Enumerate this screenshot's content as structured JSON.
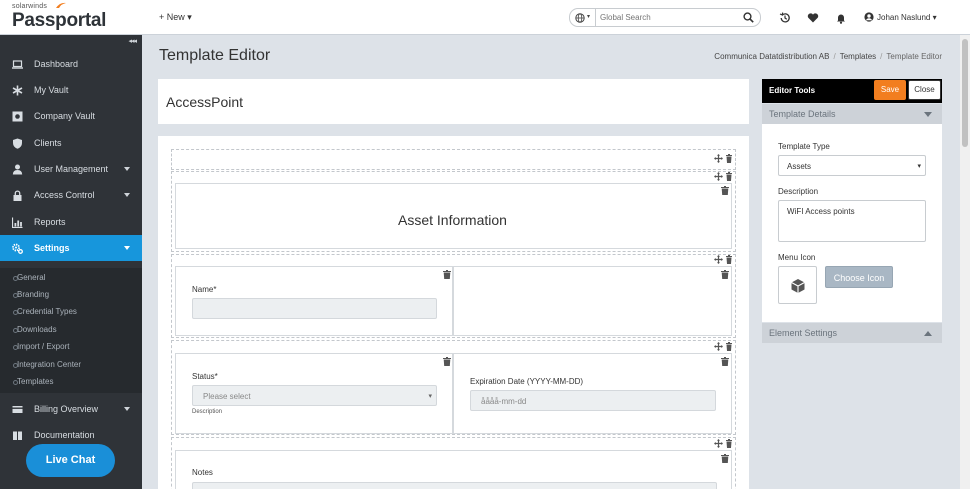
{
  "header": {
    "brand_small": "solarwinds",
    "brand_big": "Passportal",
    "new_label": "+ New ▾",
    "search_placeholder": "Global Search",
    "user_name": "Johan Naslund ▾",
    "icons": [
      "globe-icon",
      "search-icon",
      "history-icon",
      "heart-icon",
      "bell-icon",
      "user-circle-icon"
    ]
  },
  "sidebar": {
    "collapse_glyph": "◂◂◂",
    "items": [
      {
        "label": "Dashboard",
        "icon": "laptop-icon",
        "caret": false
      },
      {
        "label": "My Vault",
        "icon": "asterisk-icon",
        "caret": false
      },
      {
        "label": "Company Vault",
        "icon": "safe-icon",
        "caret": false
      },
      {
        "label": "Clients",
        "icon": "shield-icon",
        "caret": false
      },
      {
        "label": "User Management",
        "icon": "user-icon",
        "caret": true
      },
      {
        "label": "Access Control",
        "icon": "lock-icon",
        "caret": true
      },
      {
        "label": "Reports",
        "icon": "chart-icon",
        "caret": false
      },
      {
        "label": "Settings",
        "icon": "cogs-icon",
        "caret": true,
        "active": true
      }
    ],
    "subitems": [
      "General",
      "Branding",
      "Credential Types",
      "Downloads",
      "Import / Export",
      "Integration Center",
      "Templates"
    ],
    "bottom_items": [
      {
        "label": "Billing Overview",
        "icon": "card-icon",
        "caret": true
      },
      {
        "label": "Documentation",
        "icon": "book-icon",
        "caret": false
      }
    ],
    "live_chat": "Live Chat"
  },
  "page": {
    "title": "Template Editor",
    "breadcrumb": [
      "Communica Datatdistribution AB",
      "Templates",
      "Template Editor"
    ],
    "template_name": "AccessPoint"
  },
  "canvas": {
    "section_title": "Asset Information",
    "name_label": "Name*",
    "status_label": "Status*",
    "status_placeholder": "Please select",
    "status_help": "Description",
    "expiration_label": "Expiration Date (YYYY-MM-DD)",
    "expiration_placeholder": "åååå-mm-dd",
    "notes_label": "Notes"
  },
  "editor_tools": {
    "title": "Editor Tools",
    "save": "Save",
    "close": "Close",
    "template_details": "Template Details",
    "template_type_label": "Template Type",
    "template_type_value": "Assets",
    "description_label": "Description",
    "description_value": "WiFI Access points",
    "menu_icon_label": "Menu Icon",
    "menu_icon": "cube-icon",
    "choose_icon": "Choose Icon",
    "element_settings": "Element Settings"
  },
  "colors": {
    "accent": "#1796dc",
    "save": "#f27e1f",
    "sidebar": "#2f3338"
  }
}
